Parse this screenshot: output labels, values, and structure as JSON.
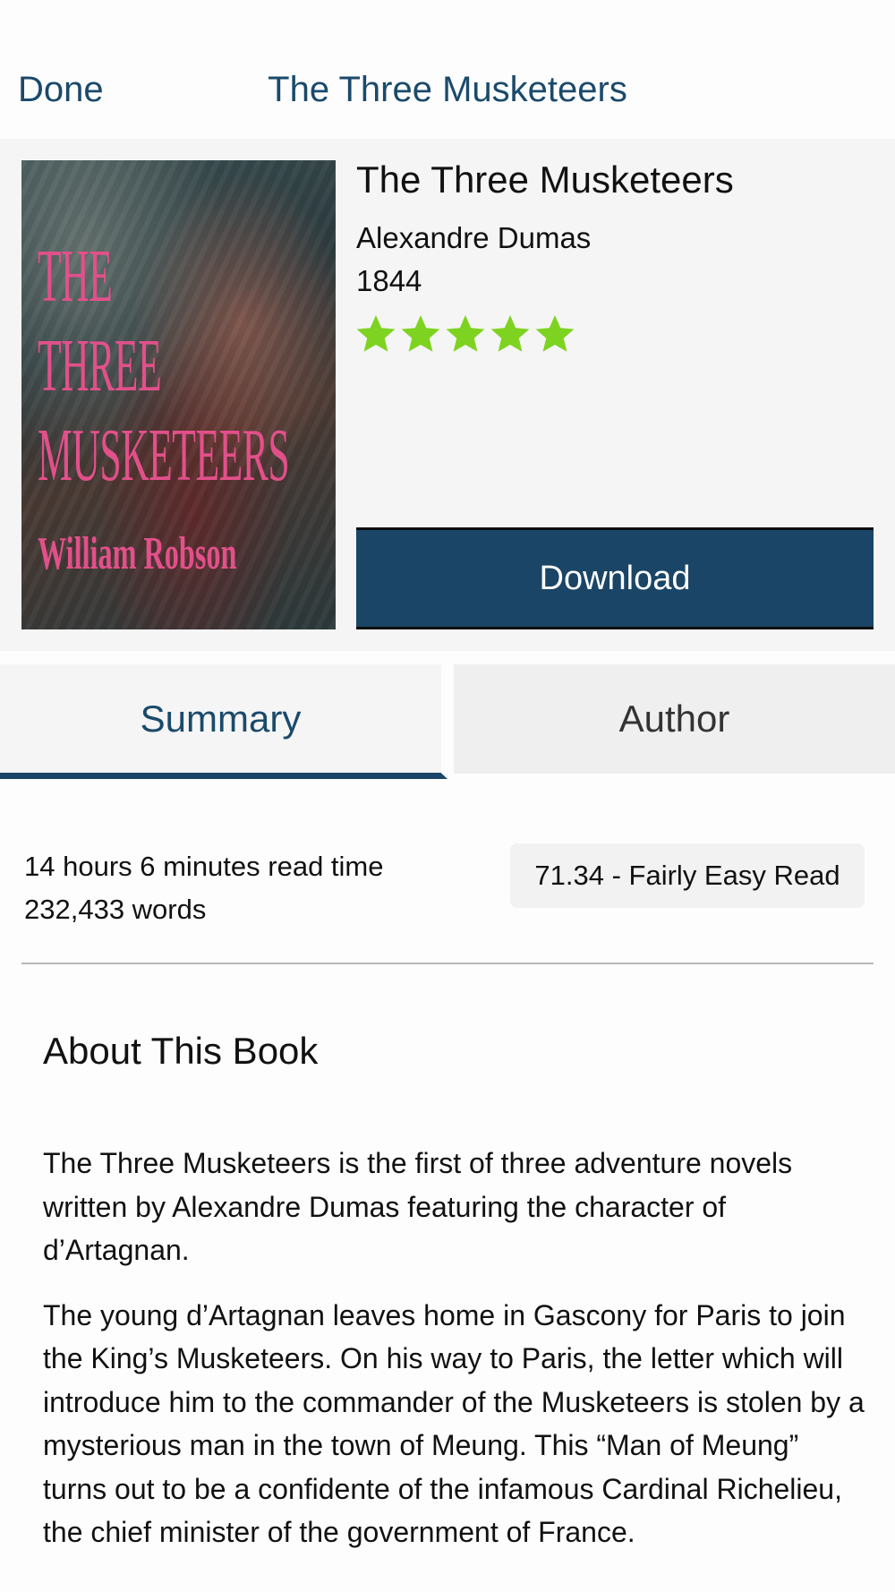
{
  "nav": {
    "done_label": "Done",
    "title": "The Three Musketeers"
  },
  "book": {
    "title": "The Three Musketeers",
    "author": "Alexandre Dumas",
    "year": "1844",
    "rating": {
      "value": 5,
      "max": 5,
      "color": "#7ed321"
    },
    "download_label": "Download",
    "cover": {
      "title_lines": [
        "THE",
        "THREE",
        "MUSKETEERS"
      ],
      "author": "William Robson",
      "text_color": "#e2508a"
    }
  },
  "tabs": [
    {
      "label": "Summary",
      "selected": true
    },
    {
      "label": "Author",
      "selected": false
    }
  ],
  "stats": {
    "read_time": "14 hours 6 minutes read time",
    "words": "232,433 words",
    "readability": "71.34 - Fairly Easy Read"
  },
  "about": {
    "heading": "About This Book",
    "paragraphs": [
      "The Three Musketeers is the first of three adventure novels written by Alexandre Dumas featuring the character of d’Artagnan.",
      "The young d’Artagnan leaves home in Gascony for Paris to join the King’s Musketeers. On his way to Paris, the letter which will introduce him to the commander of the Musketeers is stolen by a mysterious man in the town of Meung. This “Man of Meung” turns out to be a confidente of the infamous Cardinal Richelieu, the chief minister of the government of France."
    ]
  },
  "colors": {
    "accent": "#1a4566",
    "nav_text": "#1a4a6b",
    "star": "#7ed321"
  }
}
